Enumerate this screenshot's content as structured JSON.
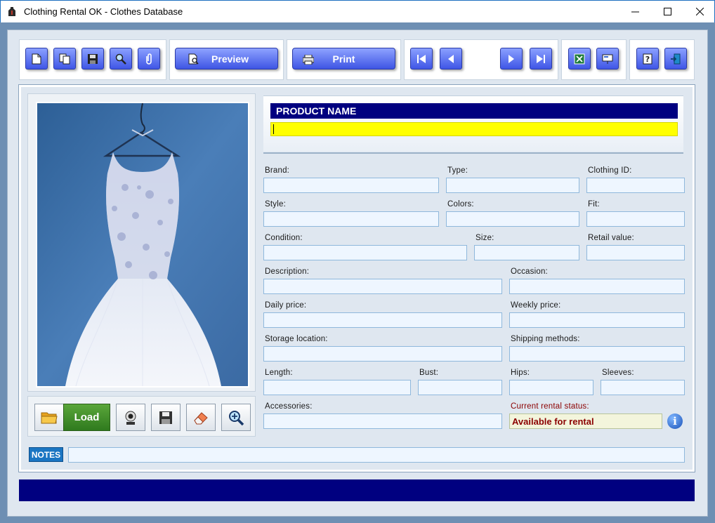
{
  "window": {
    "title": "Clothing Rental OK - Clothes Database",
    "controls": [
      "minimize-icon",
      "maximize-icon",
      "close-icon"
    ]
  },
  "toolbar": {
    "left_buttons": [
      "new-record-icon",
      "copy-record-icon",
      "save-icon",
      "search-icon",
      "attach-icon"
    ],
    "preview_label": "Preview",
    "print_label": "Print",
    "nav_buttons": [
      "first-record-icon",
      "previous-record-icon",
      "next-record-icon",
      "last-record-icon"
    ],
    "export_buttons": [
      "excel-export-icon",
      "presentation-icon"
    ],
    "help_buttons": [
      "help-icon",
      "exit-icon"
    ]
  },
  "image_panel": {
    "load_label": "Load",
    "buttons": [
      "open-folder-icon",
      "webcam-icon",
      "save-image-icon",
      "eraser-icon",
      "zoom-icon"
    ]
  },
  "product": {
    "header": "PRODUCT NAME",
    "value": ""
  },
  "form": {
    "brand": {
      "label": "Brand:",
      "value": ""
    },
    "type": {
      "label": "Type:",
      "value": ""
    },
    "clothing_id": {
      "label": "Clothing ID:",
      "value": ""
    },
    "style": {
      "label": "Style:",
      "value": ""
    },
    "colors": {
      "label": "Colors:",
      "value": ""
    },
    "fit": {
      "label": "Fit:",
      "value": ""
    },
    "condition": {
      "label": "Condition:",
      "value": ""
    },
    "size": {
      "label": "Size:",
      "value": ""
    },
    "retail_value": {
      "label": "Retail value:",
      "value": ""
    },
    "description": {
      "label": "Description:",
      "value": ""
    },
    "occasion": {
      "label": "Occasion:",
      "value": ""
    },
    "daily_price": {
      "label": "Daily price:",
      "value": ""
    },
    "weekly_price": {
      "label": "Weekly price:",
      "value": ""
    },
    "storage_location": {
      "label": "Storage location:",
      "value": ""
    },
    "shipping_methods": {
      "label": "Shipping methods:",
      "value": ""
    },
    "length": {
      "label": "Length:",
      "value": ""
    },
    "bust": {
      "label": "Bust:",
      "value": ""
    },
    "hips": {
      "label": "Hips:",
      "value": ""
    },
    "sleeves": {
      "label": "Sleeves:",
      "value": ""
    },
    "accessories": {
      "label": "Accessories:",
      "value": ""
    },
    "rental_status": {
      "label": "Current rental status:",
      "value": "Available for rental"
    }
  },
  "notes": {
    "tag": "NOTES",
    "value": ""
  },
  "colors": {
    "title_text": "#000000",
    "toolbar_button": "#4a60ea",
    "header_bar": "#000080",
    "product_input": "#ffff00",
    "field_bg": "#eef6ff",
    "status_text": "#8b0000",
    "load_button": "#3f8e28",
    "notes_tag": "#1a75c2"
  }
}
